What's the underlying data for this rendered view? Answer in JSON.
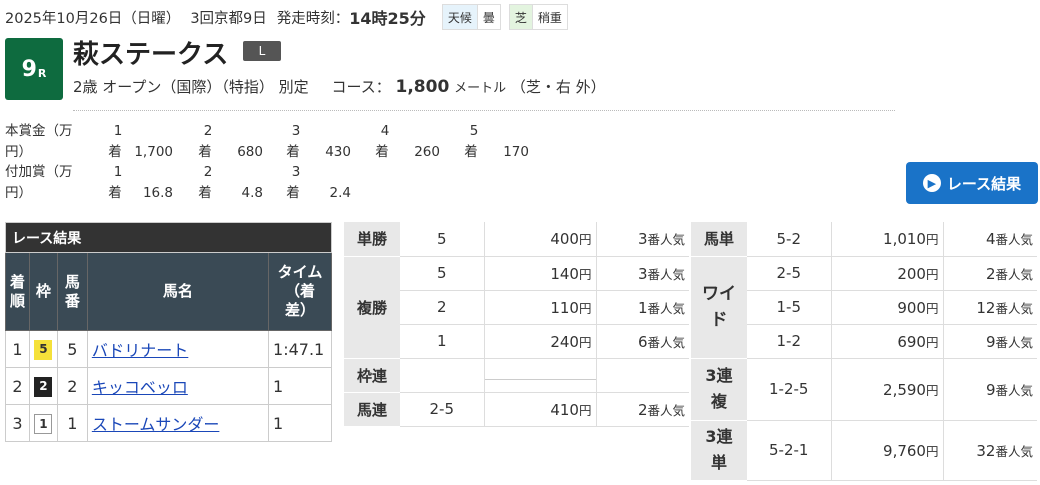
{
  "header": {
    "date": "2025年10月26日（日曜）",
    "meeting": "3回京都9日",
    "post_time_label": "発走時刻：",
    "post_time": "14時25分",
    "weather_label": "天候",
    "weather": "曇",
    "track_label": "芝",
    "track_condition": "稍重"
  },
  "race": {
    "number": "9",
    "number_suffix": "R",
    "name": "萩ステークス",
    "grade": "L",
    "conditions": "2歳 オープン（国際）（特指） 別定",
    "course_label": "コース：",
    "distance": "1,800",
    "distance_unit": "メートル",
    "surface": "（芝・右 外）"
  },
  "prize": {
    "main_label": "本賞金（万円）",
    "main": [
      {
        "place": "1",
        "unit": "着",
        "amount": "1,700"
      },
      {
        "place": "2",
        "unit": "着",
        "amount": "680"
      },
      {
        "place": "3",
        "unit": "着",
        "amount": "430"
      },
      {
        "place": "4",
        "unit": "着",
        "amount": "260"
      },
      {
        "place": "5",
        "unit": "着",
        "amount": "170"
      }
    ],
    "extra_label": "付加賞（万円）",
    "extra": [
      {
        "place": "1",
        "unit": "着",
        "amount": "16.8"
      },
      {
        "place": "2",
        "unit": "着",
        "amount": "4.8"
      },
      {
        "place": "3",
        "unit": "着",
        "amount": "2.4"
      }
    ]
  },
  "result_button": {
    "label": "レース結果",
    "icon": "chevron-right-icon"
  },
  "results": {
    "caption": "レース結果",
    "headers": {
      "place": "着順",
      "frame": "枠",
      "number": "馬番",
      "horse": "馬名",
      "time": "タイム（着差）"
    },
    "rows": [
      {
        "place": "1",
        "frame": "5",
        "number": "5",
        "horse": "バドリナート",
        "time": "1:47.1"
      },
      {
        "place": "2",
        "frame": "2",
        "number": "2",
        "horse": "キッコベッロ",
        "time": "1"
      },
      {
        "place": "3",
        "frame": "1",
        "number": "1",
        "horse": "ストームサンダー",
        "time": "1"
      }
    ]
  },
  "payouts": {
    "yen": "円",
    "ninki": "番人気",
    "tansho": {
      "label": "単勝",
      "rows": [
        {
          "comb": "5",
          "amount": "400",
          "pop": "3"
        }
      ]
    },
    "fukusho": {
      "label": "複勝",
      "rows": [
        {
          "comb": "5",
          "amount": "140",
          "pop": "3"
        },
        {
          "comb": "2",
          "amount": "110",
          "pop": "1"
        },
        {
          "comb": "1",
          "amount": "240",
          "pop": "6"
        }
      ]
    },
    "wakuren": {
      "label": "枠連"
    },
    "umaren": {
      "label": "馬連",
      "rows": [
        {
          "comb": "2-5",
          "amount": "410",
          "pop": "2"
        }
      ]
    },
    "umatan": {
      "label": "馬単",
      "rows": [
        {
          "comb": "5-2",
          "amount": "1,010",
          "pop": "4"
        }
      ]
    },
    "wide": {
      "label": "ワイド",
      "rows": [
        {
          "comb": "2-5",
          "amount": "200",
          "pop": "2"
        },
        {
          "comb": "1-5",
          "amount": "900",
          "pop": "12"
        },
        {
          "comb": "1-2",
          "amount": "690",
          "pop": "9"
        }
      ]
    },
    "sanrenpuku": {
      "label": "3連複",
      "rows": [
        {
          "comb": "1-2-5",
          "amount": "2,590",
          "pop": "9"
        }
      ]
    },
    "sanrentan": {
      "label": "3連単",
      "rows": [
        {
          "comb": "5-2-1",
          "amount": "9,760",
          "pop": "32"
        }
      ]
    }
  }
}
